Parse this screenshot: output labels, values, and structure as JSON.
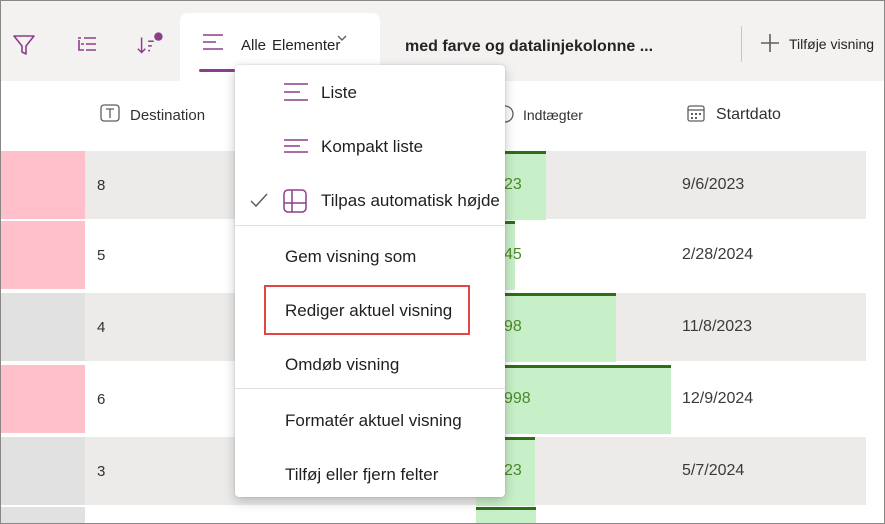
{
  "toolbar": {
    "active_view_prefix": "Alle",
    "active_view_name": "Elementer",
    "second_view": "med farve og datalinjekolonne ...",
    "add_view_label": "Tilføje visning",
    "accent_color": "#8c3e8c",
    "icons": [
      "filter-icon",
      "group-icon",
      "sort-icon",
      "view-list-icon",
      "chevron-down-icon",
      "plus-icon"
    ]
  },
  "columns": {
    "destination": "Destination",
    "income": "Indtægter",
    "start_date": "Startdato"
  },
  "rows": [
    {
      "color": "#ffc0cb",
      "number": "8",
      "income_fragment": "23",
      "income_fill": 0.18,
      "date": "9/6/2023"
    },
    {
      "color": "#ffc0cb",
      "number": "5",
      "income_fragment": "45",
      "income_fill": 0.1,
      "date": "2/28/2024"
    },
    {
      "color": "#e1e1e1",
      "number": "4",
      "income_fragment": "98",
      "income_fill": 0.36,
      "date": "11/8/2023"
    },
    {
      "color": "#ffc0cb",
      "number": "6",
      "income_fragment": "998",
      "income_fill": 0.5,
      "date": "12/9/2024"
    },
    {
      "color": "#e1e1e1",
      "number": "3",
      "income_fragment": "23",
      "income_fill": 0.15,
      "date": "5/7/2024"
    }
  ],
  "menu": {
    "items": [
      {
        "label": "Liste",
        "icon": "list-icon",
        "checked": false
      },
      {
        "label": "Kompakt liste",
        "icon": "compact-list-icon",
        "checked": false
      },
      {
        "label": "Tilpas automatisk højde",
        "icon": "autofit-icon",
        "checked": true
      },
      {
        "label": "Gem visning som"
      },
      {
        "label": "Rediger aktuel visning",
        "highlighted": true,
        "highlight_color": "#e04848"
      },
      {
        "label": "Omdøb visning"
      },
      {
        "label": "Formatér aktuel visning"
      },
      {
        "label": "Tilføj eller fjern felter"
      }
    ]
  },
  "colors": {
    "pink": "#ffc0cb",
    "gray": "#e1e1e1",
    "bar_fill": "#c8f0c8",
    "bar_line": "#2e6e17",
    "bar_text": "#4a8a2a"
  }
}
